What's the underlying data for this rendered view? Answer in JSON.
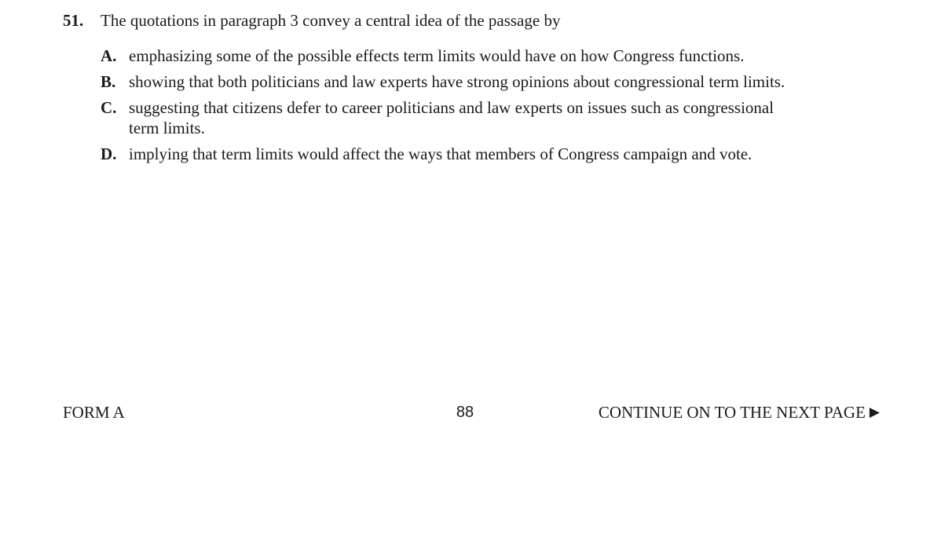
{
  "question": {
    "number": "51.",
    "stem": "The quotations in paragraph 3 convey a central idea of the passage by",
    "options": [
      {
        "letter": "A.",
        "text": "emphasizing some of the possible effects term limits would have on how Congress functions."
      },
      {
        "letter": "B.",
        "text": "showing that both politicians and law experts have strong opinions about congressional term limits."
      },
      {
        "letter": "C.",
        "text": "suggesting that citizens defer to career politicians and law experts on issues such as congressional term limits."
      },
      {
        "letter": "D.",
        "text": "implying that term limits would affect the ways that members of Congress campaign and vote."
      }
    ]
  },
  "footer": {
    "form": "FORM A",
    "page_number": "88",
    "continue_text": "CONTINUE ON TO THE NEXT PAGE",
    "arrow_icon": "right-triangle-arrow"
  }
}
